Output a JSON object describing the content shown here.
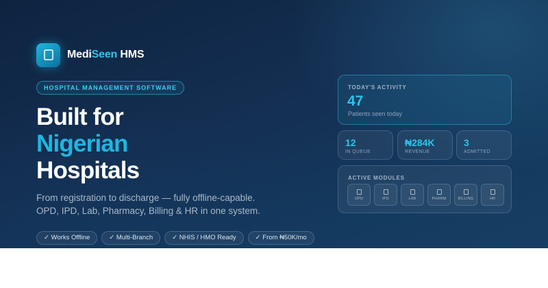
{
  "brand": {
    "name_part1": "Medi",
    "name_part2": "Seen",
    "name_part3": " HMS",
    "logo_icon": "square-icon",
    "accent_color": "#2bc4ea"
  },
  "tagline": "HOSPITAL MANAGEMENT SOFTWARE",
  "headline": {
    "line1": "Built for",
    "line2": "Nigerian",
    "line3": "Hospitals"
  },
  "subtitle": {
    "line1": "From registration to discharge — fully offline-capable.",
    "line2": "OPD, IPD, Lab, Pharmacy, Billing & HR in one system."
  },
  "features": [
    "✓ Works Offline",
    "✓ Multi-Branch",
    "✓ NHIS / HMO Ready",
    "✓ From ₦50K/mo"
  ],
  "activity": {
    "eyebrow": "TODAY'S ACTIVITY",
    "value": "47",
    "caption": "Patients seen today"
  },
  "stats": [
    {
      "value": "12",
      "label": "IN QUEUE"
    },
    {
      "value": "₦284K",
      "label": "REVENUE"
    },
    {
      "value": "3",
      "label": "ADMITTED"
    }
  ],
  "modules": {
    "eyebrow": "ACTIVE MODULES",
    "items": [
      {
        "label": "OPD",
        "icon": "square-icon"
      },
      {
        "label": "IPD",
        "icon": "square-icon"
      },
      {
        "label": "LAB",
        "icon": "square-icon"
      },
      {
        "label": "PHARM",
        "icon": "square-icon"
      },
      {
        "label": "BILLING",
        "icon": "square-icon"
      },
      {
        "label": "HR",
        "icon": "square-icon"
      }
    ]
  }
}
